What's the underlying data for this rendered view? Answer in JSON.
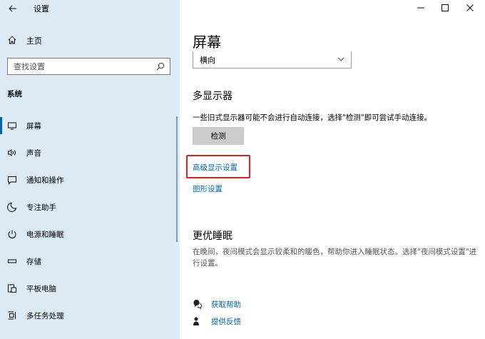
{
  "window": {
    "title": "设置",
    "minimize_icon": "minimize-icon",
    "maximize_icon": "maximize-icon",
    "close_icon": "close-icon"
  },
  "sidebar": {
    "back_icon": "back-arrow-icon",
    "home": {
      "label": "主页",
      "icon": "home-icon"
    },
    "search": {
      "placeholder": "查找设置",
      "icon": "search-icon"
    },
    "section": "系统",
    "items": [
      {
        "label": "屏幕",
        "icon": "monitor-icon",
        "active": true
      },
      {
        "label": "声音",
        "icon": "speaker-icon"
      },
      {
        "label": "通知和操作",
        "icon": "notification-icon"
      },
      {
        "label": "专注助手",
        "icon": "moon-icon"
      },
      {
        "label": "电源和睡眠",
        "icon": "power-icon"
      },
      {
        "label": "存储",
        "icon": "storage-icon"
      },
      {
        "label": "平板电脑",
        "icon": "tablet-icon"
      },
      {
        "label": "多任务处理",
        "icon": "multitask-icon"
      }
    ]
  },
  "main": {
    "title": "屏幕",
    "orientation": {
      "value": "横向",
      "icon": "chevron-down-icon"
    },
    "multi_display": {
      "heading": "多显示器",
      "description": "一些旧式显示器可能不会进行自动连接，选择\"检测\"即可尝试手动连接。",
      "detect_button": "检测"
    },
    "links": {
      "advanced_display": "高级显示设置",
      "graphics": "图形设置"
    },
    "sleep": {
      "heading": "更优睡眠",
      "description": "在晚间，夜间模式会显示较柔和的暖色，帮助你进入睡眠状态。选择\"夜间模式设置\"进行设置。"
    },
    "help": {
      "get_help": "获取帮助",
      "get_help_icon": "help-chat-icon",
      "feedback": "提供反馈",
      "feedback_icon": "feedback-icon"
    }
  },
  "colors": {
    "sidebar_bg": "#dcebf5",
    "accent": "#0063b1",
    "link": "#0066b4",
    "highlight": "#e02020"
  }
}
